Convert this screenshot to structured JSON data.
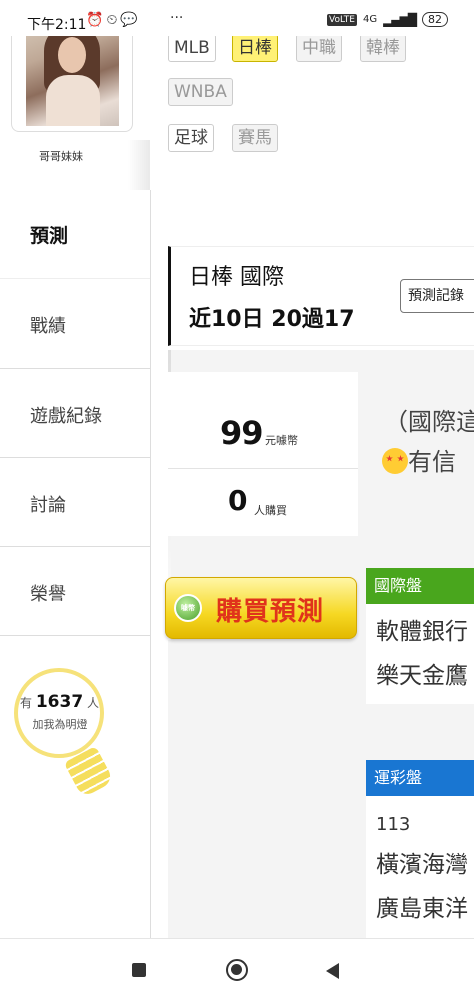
{
  "status_bar": {
    "time": "下午2:11",
    "icons_left": [
      "alarm-off-icon",
      "alarm-icon",
      "chat-icon"
    ],
    "more": "···",
    "network": "4G",
    "volte": "VoLTE",
    "battery": "82"
  },
  "sidebar": {
    "username": "哥哥妹妹",
    "items": [
      {
        "label": "預測",
        "active": true
      },
      {
        "label": "戰績",
        "active": false
      },
      {
        "label": "遊戲紀錄",
        "active": false
      },
      {
        "label": "討論",
        "active": false
      },
      {
        "label": "榮譽",
        "active": false
      }
    ],
    "fans": {
      "prefix": "有",
      "count": "1637",
      "suffix": "人",
      "caption": "加我為明燈"
    }
  },
  "tags": [
    {
      "label": "MLB",
      "state": "on"
    },
    {
      "label": "日棒",
      "state": "selected"
    },
    {
      "label": "中職",
      "state": "off"
    },
    {
      "label": "韓棒",
      "state": "off"
    },
    {
      "label": "WNBA",
      "state": "off"
    },
    {
      "label": "足球",
      "state": "on"
    },
    {
      "label": "賽馬",
      "state": "off"
    }
  ],
  "header": {
    "league": "日棒 國際",
    "record": "近10日 20過17",
    "record_button": "預測記錄"
  },
  "purchase": {
    "price": "99",
    "price_unit": "元噱幣",
    "buyers": "0",
    "buyers_unit": "人購買",
    "buy_label": "購買預測",
    "coin_label": "噱幣"
  },
  "prediction": {
    "intl_line": "（國際這",
    "fav_line": "有信"
  },
  "cards": [
    {
      "head": "國際盤",
      "color": "#49a61d",
      "lines": [
        "軟體銀行",
        "樂天金鷹"
      ]
    },
    {
      "head": "運彩盤",
      "color": "#1976d2",
      "number": "113",
      "lines": [
        "橫濱海灣",
        "廣島東洋"
      ]
    }
  ],
  "nav_bar": [
    "recents-icon",
    "home-icon",
    "back-icon"
  ]
}
